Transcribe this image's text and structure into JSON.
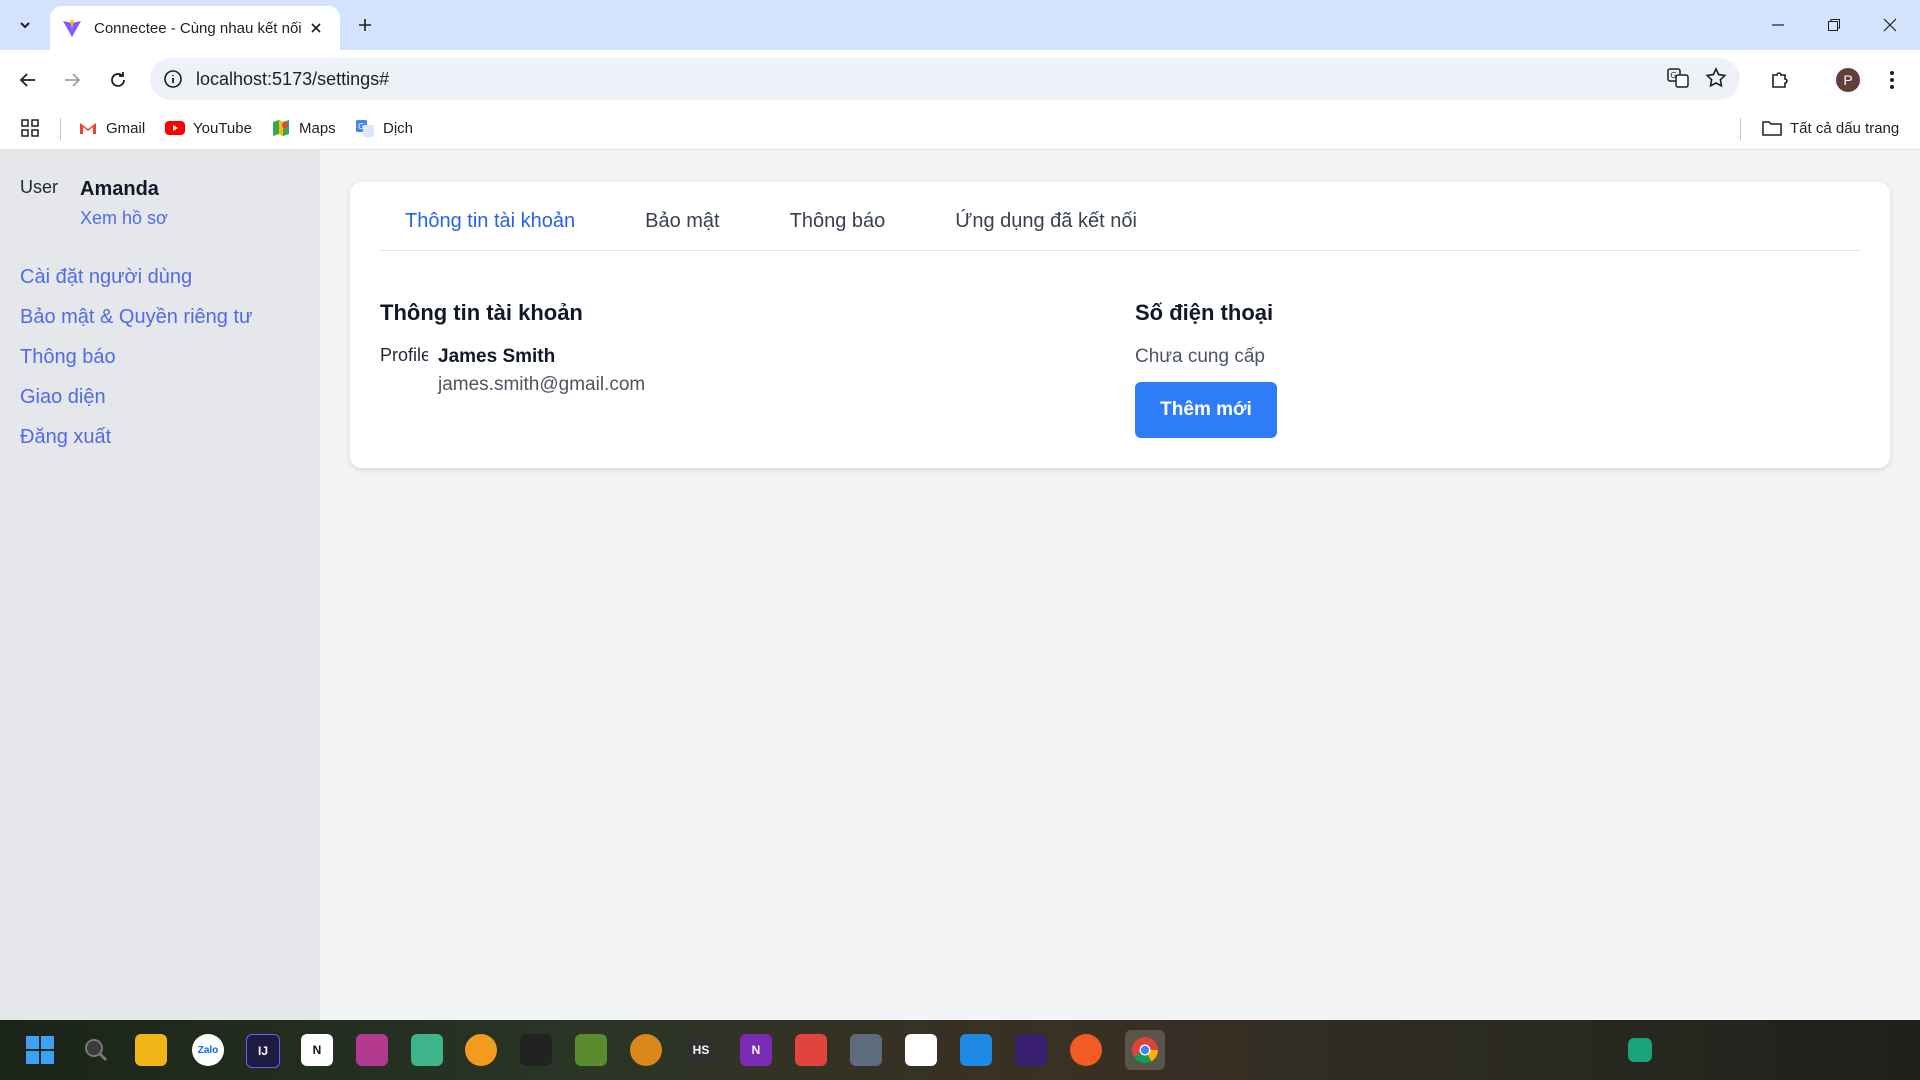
{
  "browser": {
    "tab_title": "Connectee - Cùng nhau kết nối",
    "url": "localhost:5173/settings#",
    "avatar_letter": "P",
    "bookmarks": [
      {
        "label": "Gmail"
      },
      {
        "label": "YouTube"
      },
      {
        "label": "Maps"
      },
      {
        "label": "Dịch"
      }
    ],
    "all_bookmarks": "Tất cả dấu trang"
  },
  "sidebar": {
    "avatar_alt": "User",
    "user_name": "Amanda",
    "profile_link": "Xem hồ sơ",
    "items": [
      {
        "label": "Cài đặt người dùng"
      },
      {
        "label": "Bảo mật & Quyền riêng tư"
      },
      {
        "label": "Thông báo"
      },
      {
        "label": "Giao diện"
      },
      {
        "label": "Đăng xuất"
      }
    ]
  },
  "settings": {
    "tabs": [
      {
        "label": "Thông tin tài khoản",
        "active": true
      },
      {
        "label": "Bảo mật"
      },
      {
        "label": "Thông báo"
      },
      {
        "label": "Ứng dụng đã kết nối"
      }
    ],
    "account_section_title": "Thông tin tài khoản",
    "profile_alt": "Profile",
    "account_name": "James Smith",
    "account_email": "james.smith@gmail.com",
    "phone_section_title": "Số điện thoại",
    "phone_status": "Chưa cung cấp",
    "add_button": "Thêm mới"
  },
  "colors": {
    "link": "#4f6bed",
    "active_tab": "#2563eb",
    "primary_button": "#2f7df6",
    "sidebar_bg": "#e5e7eb",
    "page_bg": "#f3f4f6"
  }
}
